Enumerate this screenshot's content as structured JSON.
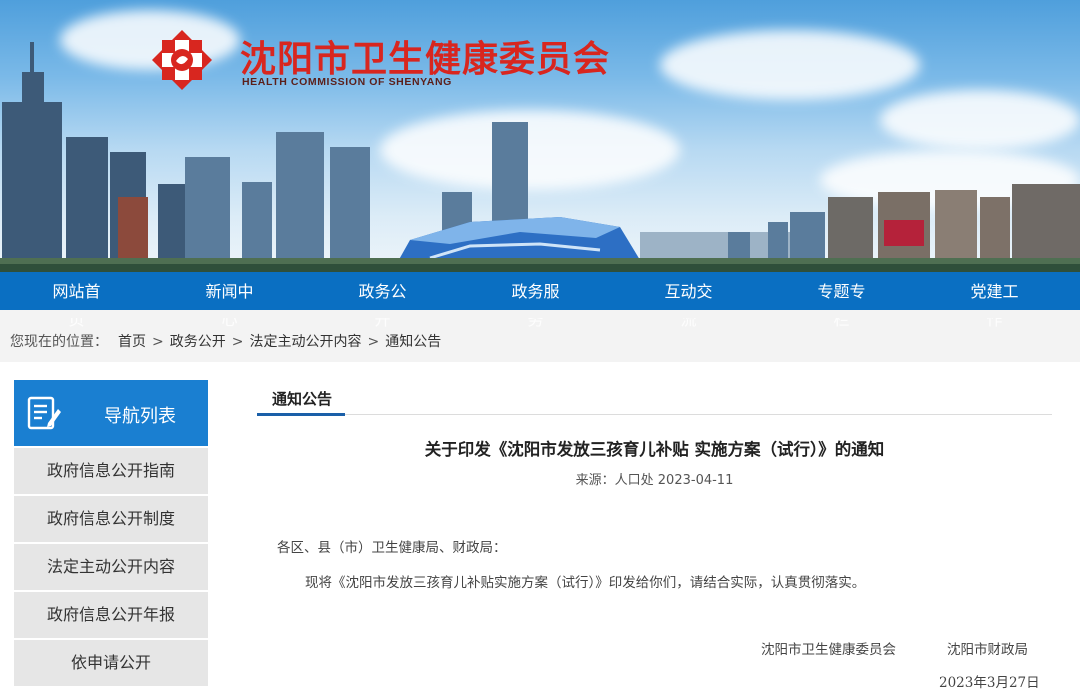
{
  "header": {
    "title": "沈阳市卫生健康委员会",
    "subtitle": "HEALTH COMMISSION OF SHENYANG"
  },
  "nav": {
    "items": [
      {
        "label": "网站首",
        "overflow": "页"
      },
      {
        "label": "新闻中",
        "overflow": "心"
      },
      {
        "label": "政务公",
        "overflow": "开"
      },
      {
        "label": "政务服",
        "overflow": "务"
      },
      {
        "label": "互动交",
        "overflow": "流"
      },
      {
        "label": "专题专",
        "overflow": "栏"
      },
      {
        "label": "党建工",
        "overflow": "作"
      }
    ]
  },
  "breadcrumb": {
    "label": "您现在的位置：",
    "items": [
      "首页",
      "政务公开",
      "法定主动公开内容",
      "通知公告"
    ],
    "separator": ">"
  },
  "sidebar": {
    "title": "导航列表",
    "items": [
      "政府信息公开指南",
      "政府信息公开制度",
      "法定主动公开内容",
      "政府信息公开年报",
      "依申请公开"
    ]
  },
  "main": {
    "tab": "通知公告",
    "article": {
      "title": "关于印发《沈阳市发放三孩育儿补贴 实施方案（试行）》的通知",
      "meta": "来源：人口处 2023-04-11",
      "salutation": "各区、县（市）卫生健康局、财政局：",
      "body": "现将《沈阳市发放三孩育儿补贴实施方案（试行）》印发给你们，请结合实际，认真贯彻落实。",
      "signatory_1": "沈阳市卫生健康委员会",
      "signatory_2": "沈阳市财政局",
      "date": "2023年3月27日"
    }
  },
  "colors": {
    "brand_red": "#d8261f",
    "nav_blue": "#0a6fc2",
    "sidebar_blue": "#1a7fd1",
    "tab_underline": "#1a5fa8"
  }
}
